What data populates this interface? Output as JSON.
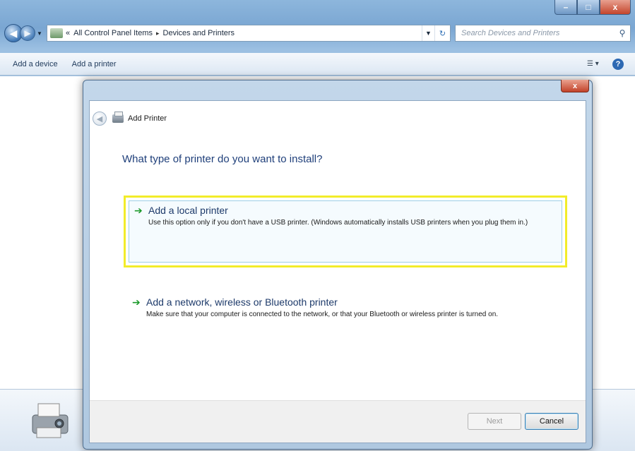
{
  "window": {
    "minimize_glyph": "–",
    "maximize_glyph": "□",
    "close_glyph": "x"
  },
  "navigation": {
    "back_glyph": "◀",
    "forward_glyph": "▶",
    "breadcrumb_prefix": "«",
    "breadcrumb": [
      "All Control Panel Items",
      "Devices and Printers"
    ],
    "breadcrumb_separator": "▸",
    "search_placeholder": "Search Devices and Printers"
  },
  "toolbar": {
    "items": [
      "Add a device",
      "Add a printer"
    ],
    "help_glyph": "?"
  },
  "dialog": {
    "title": "Add Printer",
    "close_glyph": "x",
    "question": "What type of printer do you want to install?",
    "options": [
      {
        "title": "Add a local printer",
        "description": "Use this option only if you don't have a USB printer. (Windows automatically installs USB printers when you plug them in.)",
        "selected": true
      },
      {
        "title": "Add a network, wireless or Bluetooth printer",
        "description": "Make sure that your computer is connected to the network, or that your Bluetooth or wireless printer is turned on.",
        "selected": false
      }
    ],
    "buttons": {
      "next": "Next",
      "cancel": "Cancel"
    }
  },
  "colors": {
    "highlight_border": "#f2ec2a",
    "arrow_green": "#1c9a2b",
    "heading_blue": "#1f3f7a"
  }
}
